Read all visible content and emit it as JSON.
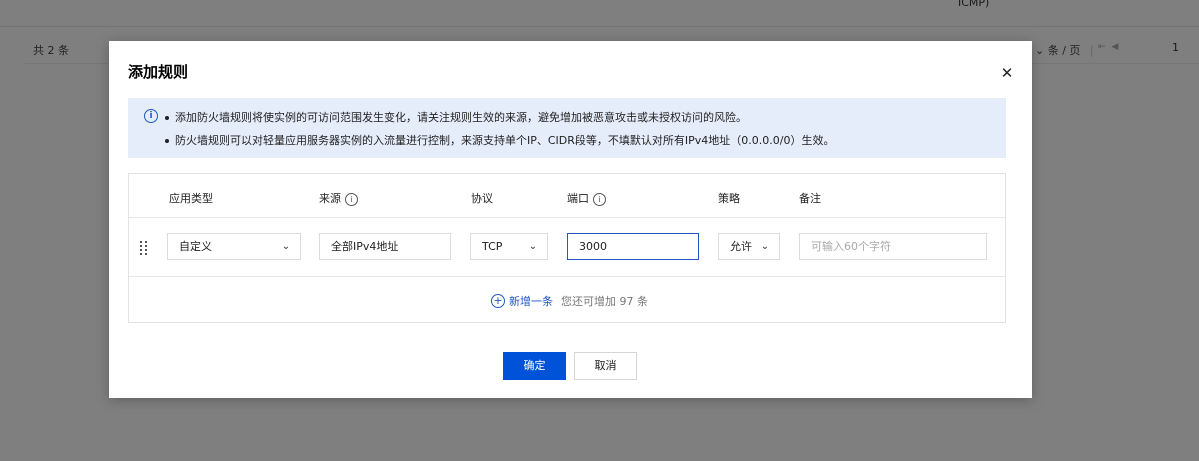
{
  "background": {
    "top_text": "ICMP)",
    "total": "共 2 条",
    "page_size_label": "条 / 页",
    "page_number": "1"
  },
  "modal": {
    "title": "添加规则",
    "notice": {
      "line1": "添加防火墙规则将使实例的可访问范围发生变化，请关注规则生效的来源，避免增加被恶意攻击或未授权访问的风险。",
      "line2": "防火墙规则可以对轻量应用服务器实例的入流量进行控制，来源支持单个IP、CIDR段等，不填默认对所有IPv4地址（0.0.0.0/0）生效。"
    },
    "table": {
      "headers": {
        "app_type": "应用类型",
        "source": "来源",
        "protocol": "协议",
        "port": "端口",
        "policy": "策略",
        "remark": "备注"
      },
      "row": {
        "app_type": "自定义",
        "source": "全部IPv4地址",
        "protocol": "TCP",
        "port": "3000",
        "policy": "允许",
        "remark_placeholder": "可输入60个字符"
      },
      "add_label": "新增一条",
      "add_hint": "您还可增加 97 条"
    },
    "ok_label": "确定",
    "cancel_label": "取消"
  },
  "colors": {
    "primary": "#0052d9",
    "notice_bg": "#e5edfb",
    "overlay": "rgba(0,0,0,0.5)"
  },
  "icons": {
    "close": "close-icon",
    "info": "info-icon",
    "help": "help-circle-icon",
    "chevron": "chevron-down-icon",
    "drag": "drag-handle-icon",
    "add": "plus-circle-icon"
  }
}
